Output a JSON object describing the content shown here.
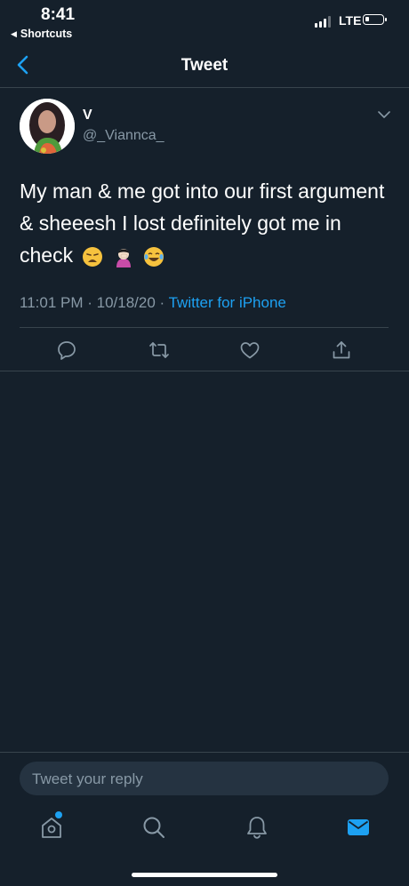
{
  "status_bar": {
    "time": "8:41",
    "back_app": "Shortcuts",
    "network": "LTE"
  },
  "nav": {
    "title": "Tweet"
  },
  "tweet": {
    "display_name": "V",
    "handle": "@_Viannca_",
    "text": "My man & me got into our first argument & sheeesh I lost definitely got me in check",
    "emojis": [
      "weary-face",
      "person-facepalming",
      "face-with-tears-of-joy"
    ],
    "timestamp": "11:01 PM · 10/18/20 ·",
    "source": "Twitter for iPhone"
  },
  "compose": {
    "placeholder": "Tweet your reply"
  },
  "colors": {
    "background": "#15202b",
    "accent": "#1da1f2",
    "secondary_text": "#8899a6",
    "divider": "#38444d"
  }
}
